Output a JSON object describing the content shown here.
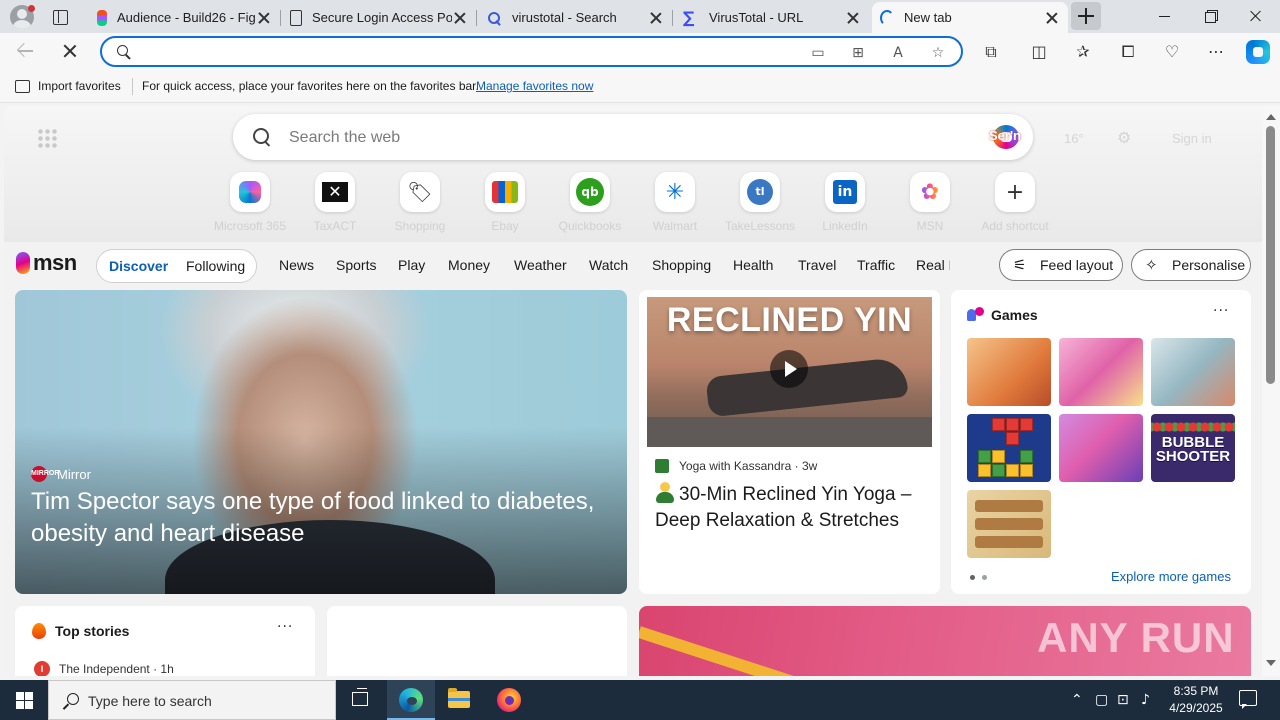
{
  "browser": {
    "tabs": [
      {
        "title": "Audience - Build26 - Fig",
        "icon": "figma-icon"
      },
      {
        "title": "Secure Login Access Port",
        "icon": "document-icon"
      },
      {
        "title": "virustotal - Search",
        "icon": "search-icon"
      },
      {
        "title": "VirusTotal - URL",
        "icon": "virustotal-icon"
      },
      {
        "title": "New tab",
        "icon": "loading-icon",
        "active": true
      }
    ],
    "address": {
      "value": "",
      "placeholder": ""
    },
    "favorites_bar": {
      "import_label": "Import favorites",
      "hint": "For quick access, place your favorites here on the favorites bar.",
      "manage_link": "Manage favorites now"
    }
  },
  "ntp": {
    "search_placeholder": "Search the web",
    "copilot_fragment": "Ser'n",
    "weather_fragment": "16°",
    "signin_fragment": "Sign in",
    "shortcuts": [
      {
        "label": "Microsoft 365",
        "icon": "microsoft-365-icon"
      },
      {
        "label": "TaxACT",
        "icon": "taxact-icon",
        "glyph": "✕"
      },
      {
        "label": "Shopping",
        "icon": "shopping-tag-icon",
        "glyph": "🏷"
      },
      {
        "label": "Ebay",
        "icon": "ebay-icon"
      },
      {
        "label": "Quickbooks",
        "icon": "quickbooks-icon",
        "glyph": "qb"
      },
      {
        "label": "Walmart",
        "icon": "walmart-icon",
        "glyph": "✳"
      },
      {
        "label": "TakeLessons",
        "icon": "takelessons-icon",
        "glyph": "tl"
      },
      {
        "label": "LinkedIn",
        "icon": "linkedin-icon",
        "glyph": "in"
      },
      {
        "label": "MSN",
        "icon": "msn-icon",
        "glyph": "✿"
      },
      {
        "label": "Add shortcut",
        "icon": "plus-icon",
        "glyph": "+"
      }
    ]
  },
  "msn": {
    "logo": "msn",
    "pill": {
      "discover": "Discover",
      "following": "Following"
    },
    "nav": [
      "News",
      "Sports",
      "Play",
      "Money",
      "Weather",
      "Watch",
      "Shopping",
      "Health",
      "Travel",
      "Traffic",
      "Real E"
    ],
    "feed_layout": "Feed layout",
    "personalise": "Personalise",
    "hero": {
      "source": "Mirror",
      "source_badge": "MIRROR",
      "title": "Tim Spector says one type of food linked to diabetes, obesity and heart disease"
    },
    "video": {
      "thumb_text": "RECLINED YIN",
      "source": "Yoga with Kassandra",
      "age": "· 3w",
      "title": "30-Min Reclined Yin Yoga – Deep Relaxation & Stretches"
    },
    "games": {
      "title": "Games",
      "bubble_text": "BUBBLE SHOOTER",
      "explore": "Explore more games"
    },
    "top_stories": {
      "title": "Top stories",
      "source": "The Independent · 1h",
      "source_badge": "I"
    },
    "watermark": "ANY RUN"
  },
  "taskbar": {
    "search_placeholder": "Type here to search",
    "time": "8:35 PM",
    "date": "4/29/2025"
  }
}
